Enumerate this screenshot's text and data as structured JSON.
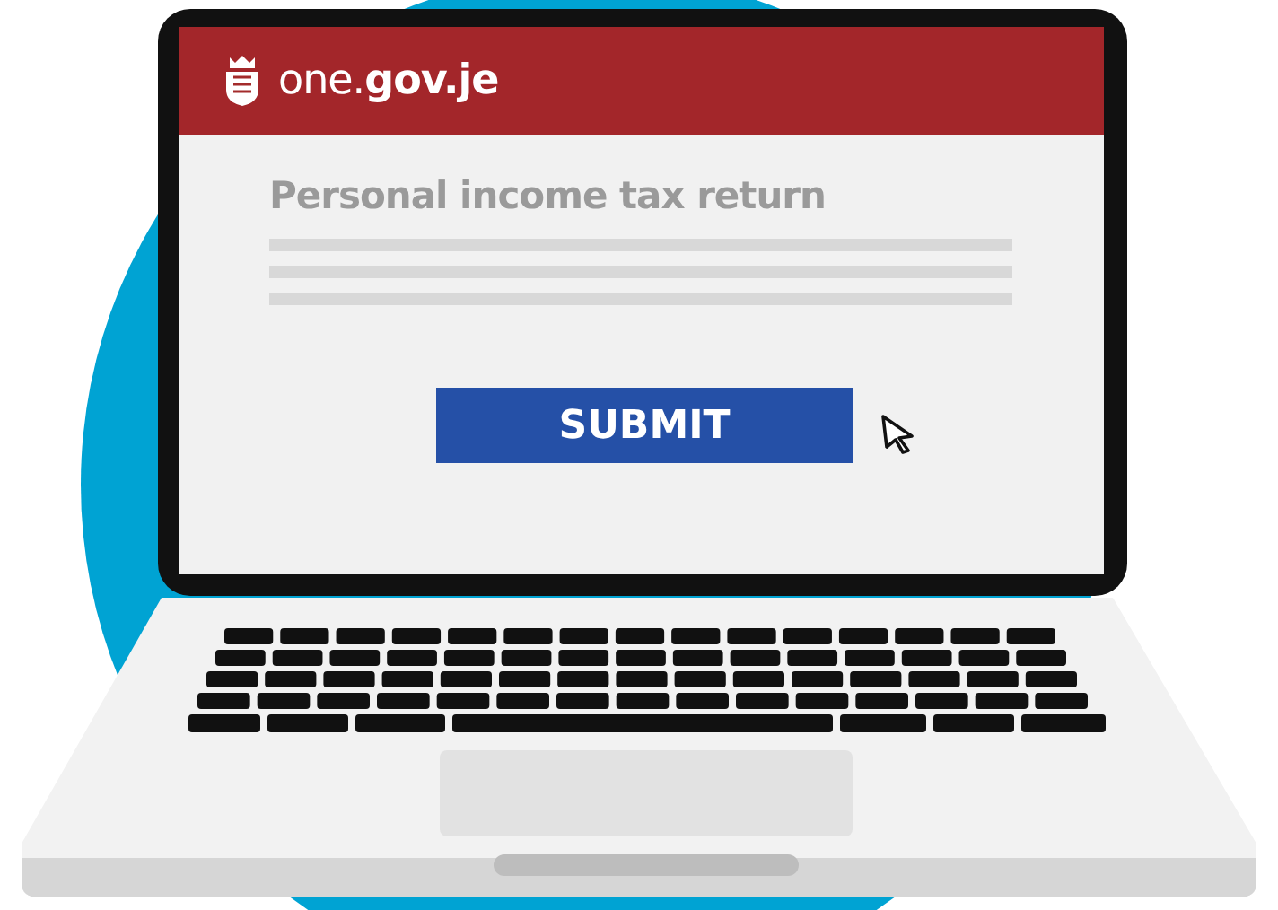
{
  "header": {
    "logo": "one.**gov.je**"
  },
  "page": {
    "title": "Personal income tax return",
    "button": "SUBMIT"
  }
}
